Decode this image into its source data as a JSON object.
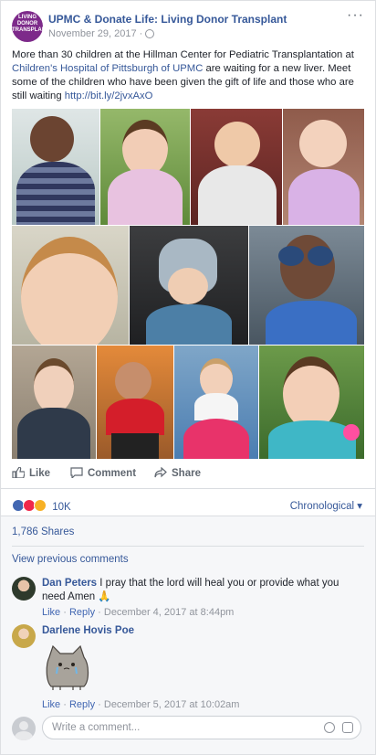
{
  "post": {
    "page_name": "UPMC & Donate Life: Living Donor Transplant",
    "date": "November 29, 2017 ·",
    "avatar_text": "LIVING DONOR TRANSPLANT",
    "text_before_link": "More than 30 children at the Hillman Center for Pediatric Transplantation at ",
    "link_hospital": "Children's Hospital of Pittsburgh of UPMC",
    "text_after_link": " are waiting for a new liver. Meet some of the children who have been given the gift of life and those who are still waiting ",
    "link_url": "http://bit.ly/2jvxAxO",
    "more_icon": "···"
  },
  "actions": {
    "like": "Like",
    "comment": "Comment",
    "share": "Share"
  },
  "reactions": {
    "count": "10K",
    "icons": [
      "like-icon",
      "love-icon",
      "sad-icon"
    ],
    "sort": "Chronological ▾"
  },
  "shares": "1,786 Shares",
  "view_previous": "View previous comments",
  "comments": [
    {
      "name": "Dan Peters",
      "text": "I pray that the lord will heal you or provide what you need Amen 🙏",
      "like": "Like",
      "reply": "Reply",
      "date": "December 4, 2017 at 8:44pm"
    },
    {
      "name": "Darlene Hovis Poe",
      "text": "",
      "like": "Like",
      "reply": "Reply",
      "date": "December 5, 2017 at 10:02am"
    }
  ],
  "composer": {
    "placeholder": "Write a comment..."
  },
  "colors": {
    "link": "#365899",
    "like": "#4267b2",
    "love": "#f0284a",
    "sad": "#f7b125"
  }
}
